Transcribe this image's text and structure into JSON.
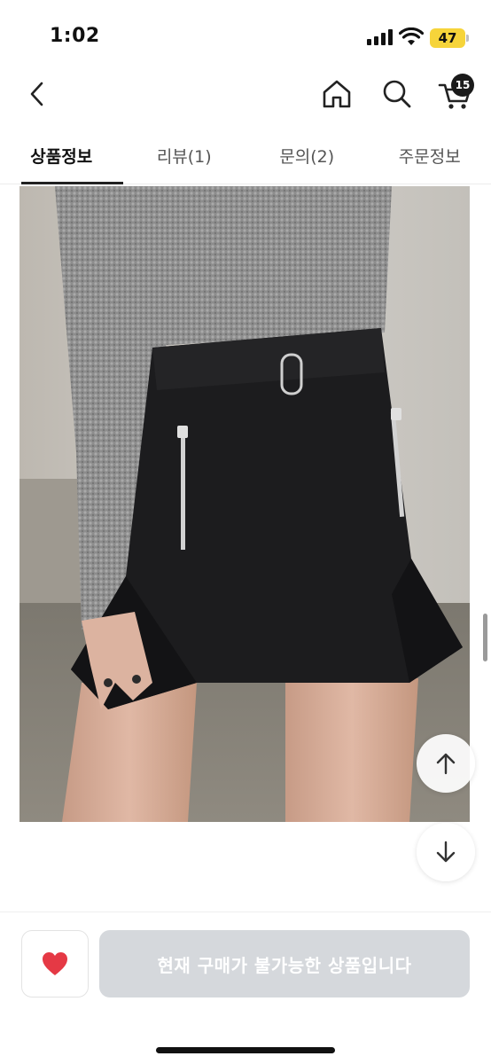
{
  "status_bar": {
    "time": "1:02",
    "battery": "47"
  },
  "header": {
    "cart_count": "15"
  },
  "tabs": [
    {
      "label": "상품정보",
      "active": true
    },
    {
      "label": "리뷰(1)",
      "active": false
    },
    {
      "label": "문의(2)",
      "active": false
    },
    {
      "label": "주문정보",
      "active": false
    }
  ],
  "bottom_bar": {
    "buy_label": "현재 구매가 불가능한 상품입니다"
  },
  "colors": {
    "heart": "#e53945",
    "buy_button_bg": "#d5d8dc",
    "battery": "#f6d43a",
    "badge": "#1a1a1a"
  },
  "icons": [
    "back-icon",
    "home-icon",
    "search-icon",
    "cart-icon",
    "arrow-up-icon",
    "arrow-down-icon",
    "heart-icon"
  ]
}
